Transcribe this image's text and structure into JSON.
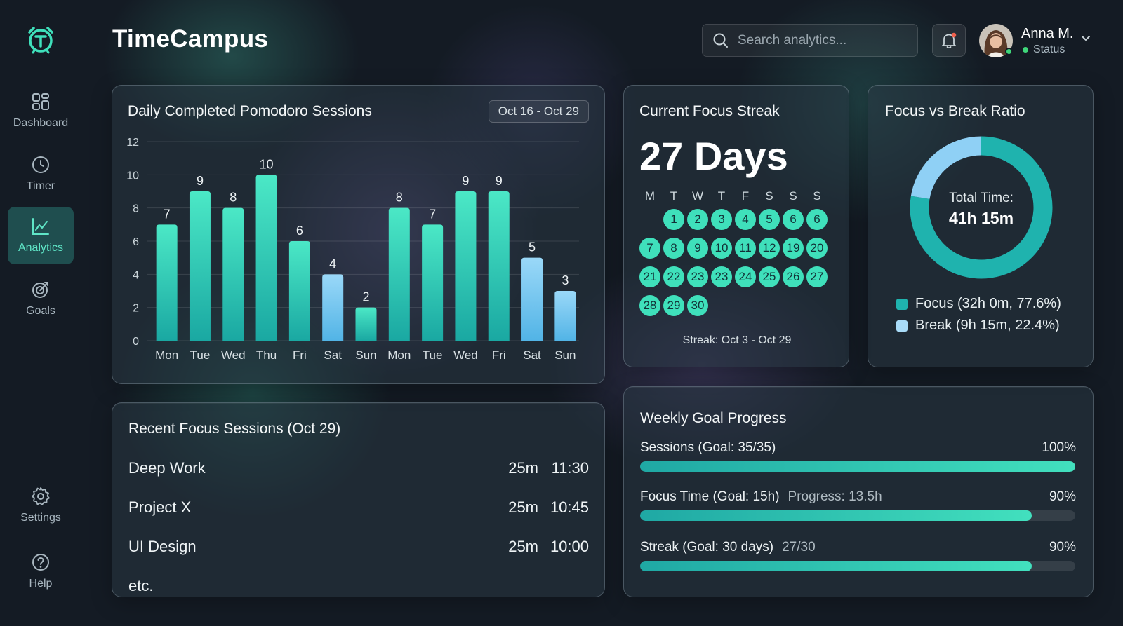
{
  "app": {
    "title": "TimeCampus"
  },
  "sidebar": {
    "items": [
      {
        "label": "Dashboard",
        "icon": "grid-icon",
        "active": false
      },
      {
        "label": "Timer",
        "icon": "clock-icon",
        "active": false
      },
      {
        "label": "Analytics",
        "icon": "chart-line-icon",
        "active": true
      },
      {
        "label": "Goals",
        "icon": "target-icon",
        "active": false
      }
    ],
    "bottom_items": [
      {
        "label": "Settings",
        "icon": "gear-icon"
      },
      {
        "label": "Help",
        "icon": "help-icon"
      }
    ]
  },
  "header": {
    "search_placeholder": "Search analytics...",
    "user_name": "Anna M.",
    "user_status": "Status"
  },
  "colors": {
    "accent": "#3fe0bb",
    "accent_dark": "#1fa8a4",
    "weekend_bar": "#7fc8f0",
    "background": "#141b24"
  },
  "bar_card": {
    "title": "Daily Completed Pomodoro Sessions",
    "range": "Oct 16 - Oct 29"
  },
  "chart_data": {
    "type": "bar",
    "categories": [
      "Mon",
      "Tue",
      "Wed",
      "Thu",
      "Fri",
      "Sat",
      "Sun",
      "Mon",
      "Tue",
      "Wed",
      "Fri",
      "Sat",
      "Sun"
    ],
    "values": [
      7,
      9,
      8,
      10,
      6,
      4,
      2,
      8,
      7,
      9,
      9,
      5,
      3
    ],
    "bar_colors": [
      "teal",
      "teal",
      "teal",
      "teal",
      "teal",
      "blue",
      "teal",
      "teal",
      "teal",
      "teal",
      "teal",
      "blue",
      "blue"
    ],
    "ylim": [
      0,
      12
    ],
    "yticks": [
      0,
      2,
      4,
      6,
      8,
      10,
      12
    ],
    "grid": true,
    "title": "Daily Completed Pomodoro Sessions"
  },
  "streak": {
    "title": "Current Focus Streak",
    "value": "27 Days",
    "weekdays": [
      "M",
      "T",
      "W",
      "T",
      "F",
      "S",
      "S",
      "S"
    ],
    "rows": [
      [
        "",
        "1",
        "2",
        "3",
        "4",
        "5",
        "6",
        "6"
      ],
      [
        "7",
        "8",
        "9",
        "10",
        "11",
        "12",
        "19",
        "20"
      ],
      [
        "21",
        "22",
        "23",
        "23",
        "24",
        "25",
        "26",
        "27"
      ],
      [
        "28",
        "29",
        "30"
      ]
    ],
    "range": "Streak: Oct 3 - Oct 29"
  },
  "ratio": {
    "title": "Focus vs Break Ratio",
    "center_label": "Total Time:",
    "center_value": "41h 15m",
    "slices": [
      {
        "label": "Focus (32h 0m, 77.6%)",
        "value": 77.6,
        "color": "#1fb3ae"
      },
      {
        "label": "Break (9h 15m, 22.4%)",
        "value": 22.4,
        "color": "#8fd0f5"
      }
    ]
  },
  "recent": {
    "title": "Recent Focus Sessions (Oct 29)",
    "sessions": [
      {
        "name": "Deep Work",
        "duration": "25m",
        "time": "11:30"
      },
      {
        "name": "Project X",
        "duration": "25m",
        "time": "10:45"
      },
      {
        "name": "UI Design",
        "duration": "25m",
        "time": "10:00"
      }
    ],
    "more": "etc."
  },
  "goals": {
    "title": "Weekly Goal Progress",
    "items": [
      {
        "label": "Sessions (Goal: 35/35)",
        "sub": "",
        "pct_label": "100%",
        "progress": 1.0
      },
      {
        "label": "Focus Time (Goal: 15h)",
        "sub": "Progress: 13.5h",
        "pct_label": "90%",
        "progress": 0.9
      },
      {
        "label": "Streak (Goal: 30 days)",
        "sub": "27/30",
        "pct_label": "90%",
        "progress": 0.9
      }
    ]
  }
}
